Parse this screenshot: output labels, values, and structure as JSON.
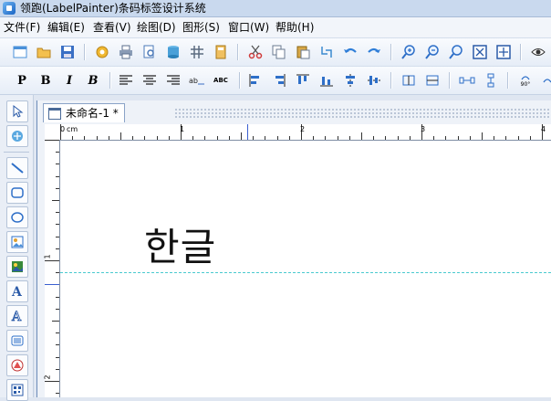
{
  "window": {
    "title": "领跑(LabelPainter)条码标签设计系统"
  },
  "menu": [
    {
      "label": "文件(F)"
    },
    {
      "label": "编辑(E)"
    },
    {
      "label": "查看(V)"
    },
    {
      "label": "绘图(D)"
    },
    {
      "label": "图形(S)"
    },
    {
      "label": "窗口(W)"
    },
    {
      "label": "帮助(H)"
    }
  ],
  "toolbar1": [
    {
      "icon": "new-icon",
      "color": "#4a90d9"
    },
    {
      "icon": "open-icon",
      "color": "#e5a93a"
    },
    {
      "icon": "save-icon",
      "color": "#3a6fc4"
    },
    {
      "icon": "settings-icon",
      "color": "#e0a020"
    },
    {
      "icon": "print-icon",
      "color": "#5a6e8c"
    },
    {
      "icon": "print-preview-icon",
      "color": "#4a78b8"
    },
    {
      "icon": "database-icon",
      "color": "#4aa0d8"
    },
    {
      "icon": "grid-icon",
      "color": "#5c6c80"
    },
    {
      "icon": "calculator-icon",
      "color": "#d89a30"
    },
    {
      "icon": "cut-icon",
      "color": "#d03a3a"
    },
    {
      "icon": "copy-icon",
      "color": "#6a7a90"
    },
    {
      "icon": "paste-icon",
      "color": "#c8962c"
    },
    {
      "icon": "replace-icon",
      "color": "#3a8ad0"
    },
    {
      "icon": "undo-icon",
      "color": "#2f7ed8"
    },
    {
      "icon": "redo-icon",
      "color": "#2f7ed8"
    },
    {
      "icon": "zoom-in-icon",
      "color": "#2e6fc8"
    },
    {
      "icon": "zoom-out-icon",
      "color": "#2e6fc8"
    },
    {
      "icon": "zoom-actual-icon",
      "color": "#2e6fc8"
    },
    {
      "icon": "fit-page-icon",
      "color": "#2a5aa8"
    },
    {
      "icon": "fit-width-icon",
      "color": "#2a5aa8"
    },
    {
      "icon": "eye-icon",
      "color": "#333333"
    }
  ],
  "toolbar2": {
    "plain_label": "P",
    "bold_label": "B",
    "italic_label": "I",
    "bold_italic_label": "B",
    "abc_label": "ABC",
    "rotate_label": "90°"
  },
  "toolbar2_icons": [
    {
      "icon": "align-left-icon"
    },
    {
      "icon": "align-center-icon"
    },
    {
      "icon": "align-right-icon"
    },
    {
      "icon": "letter-spacing-icon"
    },
    {
      "icon": "align-objects-left-icon",
      "color": "#2e6fc8"
    },
    {
      "icon": "align-objects-right-icon",
      "color": "#2e6fc8"
    },
    {
      "icon": "align-objects-top-icon",
      "color": "#2e6fc8"
    },
    {
      "icon": "align-objects-bottom-icon",
      "color": "#2e6fc8"
    },
    {
      "icon": "center-horizontal-icon",
      "color": "#2e6fc8"
    },
    {
      "icon": "center-vertical-icon",
      "color": "#2e6fc8"
    },
    {
      "icon": "same-width-icon",
      "color": "#2e6fc8"
    },
    {
      "icon": "same-height-icon",
      "color": "#2e6fc8"
    },
    {
      "icon": "distribute-horizontal-icon",
      "color": "#2e6fc8"
    },
    {
      "icon": "distribute-vertical-icon",
      "color": "#2e6fc8"
    }
  ],
  "left_tools": [
    {
      "icon": "select-arrow-icon"
    },
    {
      "icon": "pan-icon"
    },
    {
      "icon": "line-icon"
    },
    {
      "icon": "rounded-rectangle-icon"
    },
    {
      "icon": "ellipse-icon"
    },
    {
      "icon": "image-icon"
    },
    {
      "icon": "picture-icon"
    },
    {
      "icon": "text-icon"
    },
    {
      "icon": "outline-text-icon"
    },
    {
      "icon": "barcode-icon"
    },
    {
      "icon": "shape-icon"
    },
    {
      "icon": "qrcode-icon"
    }
  ],
  "document": {
    "tab_label": "未命名-1 *",
    "ruler_unit": "cm",
    "hruler_numbers": [
      "0",
      "1",
      "2",
      "3",
      "4"
    ],
    "vruler_numbers": [
      "1",
      "2"
    ],
    "canvas_text": "한글"
  },
  "colors": {
    "guide_line": "#49c9cf",
    "ruler_marker": "#3a5fd0",
    "toolbar_bg": "#e6edf7"
  }
}
